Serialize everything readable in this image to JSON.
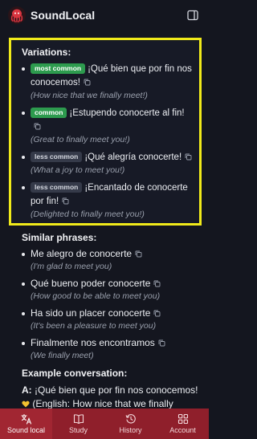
{
  "header": {
    "app_name": "SoundLocal"
  },
  "variations": {
    "title": "Variations:",
    "items": [
      {
        "badge": "most common",
        "badge_type": "most",
        "phrase": "¡Qué bien que por fin nos conocemos!",
        "translation": "(How nice that we finally meet!)"
      },
      {
        "badge": "common",
        "badge_type": "common",
        "phrase": "¡Estupendo conocerte al fin!",
        "translation": "(Great to finally meet you!)"
      },
      {
        "badge": "less common",
        "badge_type": "less",
        "phrase": "¡Qué alegría conocerte!",
        "translation": "(What a joy to meet you!)"
      },
      {
        "badge": "less common",
        "badge_type": "less",
        "phrase": "¡Encantado de conocerte por fin!",
        "translation": "(Delighted to finally meet you!)"
      }
    ]
  },
  "similar": {
    "title": "Similar phrases:",
    "items": [
      {
        "phrase": "Me alegro de conocerte",
        "translation": "(I'm glad to meet you)"
      },
      {
        "phrase": "Qué bueno poder conocerte",
        "translation": "(How good to be able to meet you)"
      },
      {
        "phrase": "Ha sido un placer conocerte",
        "translation": "(It's been a pleasure to meet you)"
      },
      {
        "phrase": "Finalmente nos encontramos",
        "translation": "(We finally meet)"
      }
    ]
  },
  "example": {
    "title": "Example conversation:",
    "speaker": "A",
    "line": "¡Qué bien que por fin nos conocemos!",
    "translation": "(English: How nice that we finally"
  },
  "nav": {
    "items": [
      {
        "label": "Sound local",
        "icon": "translate-icon",
        "active": true
      },
      {
        "label": "Study",
        "icon": "book-icon",
        "active": false
      },
      {
        "label": "History",
        "icon": "history-icon",
        "active": false
      },
      {
        "label": "Account",
        "icon": "grid-icon",
        "active": false
      }
    ]
  },
  "colors": {
    "background": "#14161f",
    "highlight_border": "#f0ea1a",
    "badge_green": "#2d9b4e",
    "badge_gray": "#353a49",
    "nav_background": "#8f1f2b"
  }
}
